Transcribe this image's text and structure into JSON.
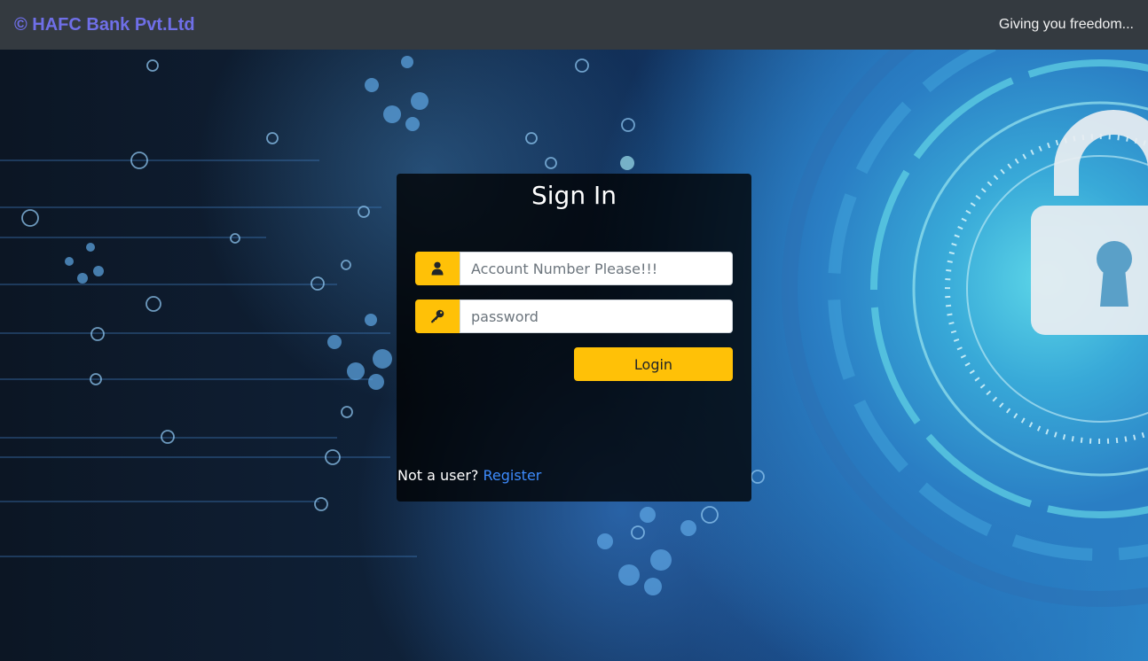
{
  "navbar": {
    "brand": "© HAFC Bank Pvt.Ltd",
    "tagline": "Giving you freedom..."
  },
  "login_card": {
    "title": "Sign In",
    "account_field": {
      "placeholder": "Account Number Please!!!",
      "value": "",
      "icon": "user-icon"
    },
    "password_field": {
      "placeholder": "password",
      "value": "",
      "icon": "key-icon"
    },
    "login_label": "Login",
    "not_user_text": "Not a user?",
    "register_label": "Register"
  },
  "colors": {
    "navbar_bg": "#343a40",
    "brand": "#6f6fe8",
    "accent": "#ffc107",
    "link": "#3d8bfd",
    "card_bg": "rgba(0,0,0,0.78)"
  }
}
